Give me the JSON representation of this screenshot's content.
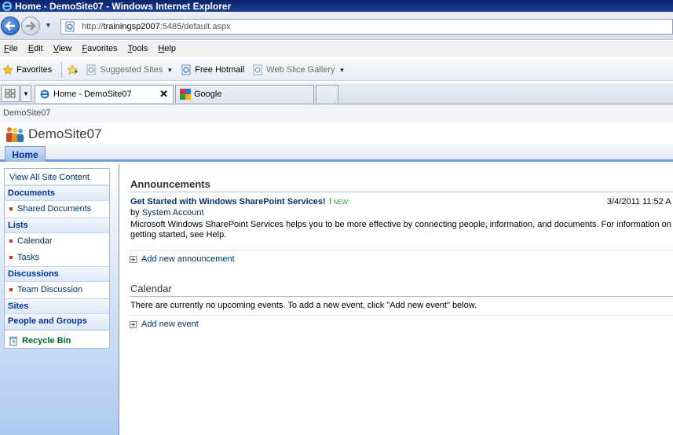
{
  "window": {
    "title": "Home - DemoSite07 - Windows Internet Explorer"
  },
  "address_bar": {
    "url_prefix": "http://",
    "host": "trainingsp2007",
    "url_rest": ":5485/default.aspx"
  },
  "menu": [
    "File",
    "Edit",
    "View",
    "Favorites",
    "Tools",
    "Help"
  ],
  "favorites_bar": {
    "favorites_label": "Favorites",
    "items": [
      {
        "label": "Suggested Sites",
        "has_dropdown": true
      },
      {
        "label": "Free Hotmail",
        "has_dropdown": false
      },
      {
        "label": "Web Slice Gallery",
        "has_dropdown": true
      }
    ]
  },
  "tabs": [
    {
      "label": "Home - DemoSite07",
      "active": true
    },
    {
      "label": "Google",
      "active": false
    }
  ],
  "sharepoint": {
    "breadcrumb": "DemoSite07",
    "site_title": "DemoSite07",
    "top_nav": {
      "home_label": "Home"
    },
    "quick_launch": {
      "view_all": "View All Site Content",
      "documents": {
        "header": "Documents",
        "items": [
          "Shared Documents"
        ]
      },
      "lists": {
        "header": "Lists",
        "items": [
          "Calendar",
          "Tasks"
        ]
      },
      "discussions": {
        "header": "Discussions",
        "items": [
          "Team Discussion"
        ]
      },
      "sites_header": "Sites",
      "people_header": "People and Groups",
      "recycle_bin": "Recycle Bin"
    },
    "announcements": {
      "title": "Announcements",
      "item": {
        "headline": "Get Started with Windows SharePoint Services!",
        "new_flag": "NEW",
        "new_bang": "!",
        "date": "3/4/2011 11:52 A",
        "by_label": "by",
        "author": "System Account",
        "body": "Microsoft Windows SharePoint Services helps you to be more effective by connecting people, information, and documents. For information on getting started, see Help."
      },
      "add_link": "Add new announcement"
    },
    "calendar": {
      "title": "Calendar",
      "empty_message": "There are currently no upcoming events. To add a new event, click \"Add new event\" below.",
      "add_link": "Add new event"
    }
  }
}
